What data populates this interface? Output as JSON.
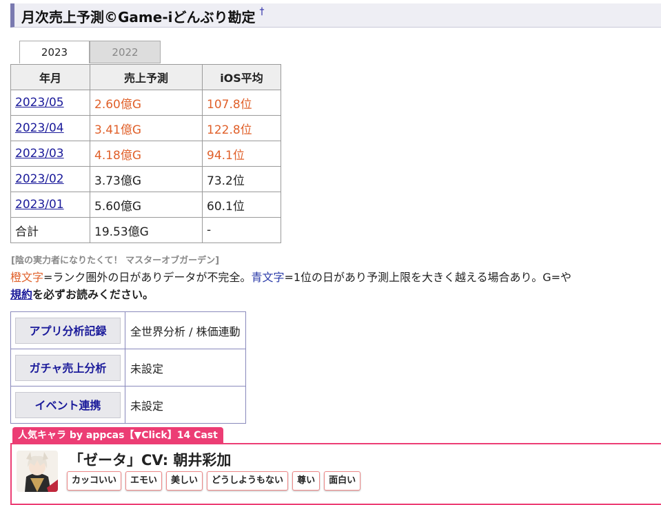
{
  "header": {
    "title": "月次売上予測©Game-iどんぶり勘定",
    "anchor": "†"
  },
  "tabs": [
    {
      "label": "2023",
      "active": true
    },
    {
      "label": "2022",
      "active": false
    }
  ],
  "table": {
    "headers": [
      "年月",
      "売上予測",
      "iOS平均"
    ],
    "rows": [
      {
        "month": "2023/05",
        "sales": "2.60億G",
        "ios": "107.8位",
        "highlight": true
      },
      {
        "month": "2023/04",
        "sales": "3.41億G",
        "ios": "122.8位",
        "highlight": true
      },
      {
        "month": "2023/03",
        "sales": "4.18億G",
        "ios": "94.1位",
        "highlight": true
      },
      {
        "month": "2023/02",
        "sales": "3.73億G",
        "ios": "73.2位",
        "highlight": false
      },
      {
        "month": "2023/01",
        "sales": "5.60億G",
        "ios": "60.1位",
        "highlight": false
      }
    ],
    "total": {
      "label": "合計",
      "sales": "19.53億G",
      "ios": "-"
    }
  },
  "game_subtitle": "[陰の実力者になりたくて！ マスターオブガーデン]",
  "note": {
    "orange_word": "橙文字",
    "text1": "=ランク圏外の日がありデータが不完全。",
    "blue_word": "青文字",
    "text2": "=1位の日があり予測上限を大きく越える場合あり。G=や",
    "line2_link": "規約",
    "line2_text": "を必ずお読みください。"
  },
  "links": [
    {
      "button": "アプリ分析記録",
      "value": "全世界分析 / 株価連動"
    },
    {
      "button": "ガチャ売上分析",
      "value": "未設定"
    },
    {
      "button": "イベント連携",
      "value": "未設定"
    }
  ],
  "popular": {
    "tag": "人気キャラ by appcas【▼Click】14 Cast",
    "character": "「ゼータ」CV: 朝井彩加",
    "tags": [
      "カッコいい",
      "エモい",
      "美しい",
      "どうしようもない",
      "尊い",
      "面白い"
    ]
  },
  "colors": {
    "accent": "#7a7ab0",
    "orange": "#e0602a",
    "blue": "#2a3aa8",
    "pink": "#ec3d74",
    "link": "#1a1a9a"
  }
}
